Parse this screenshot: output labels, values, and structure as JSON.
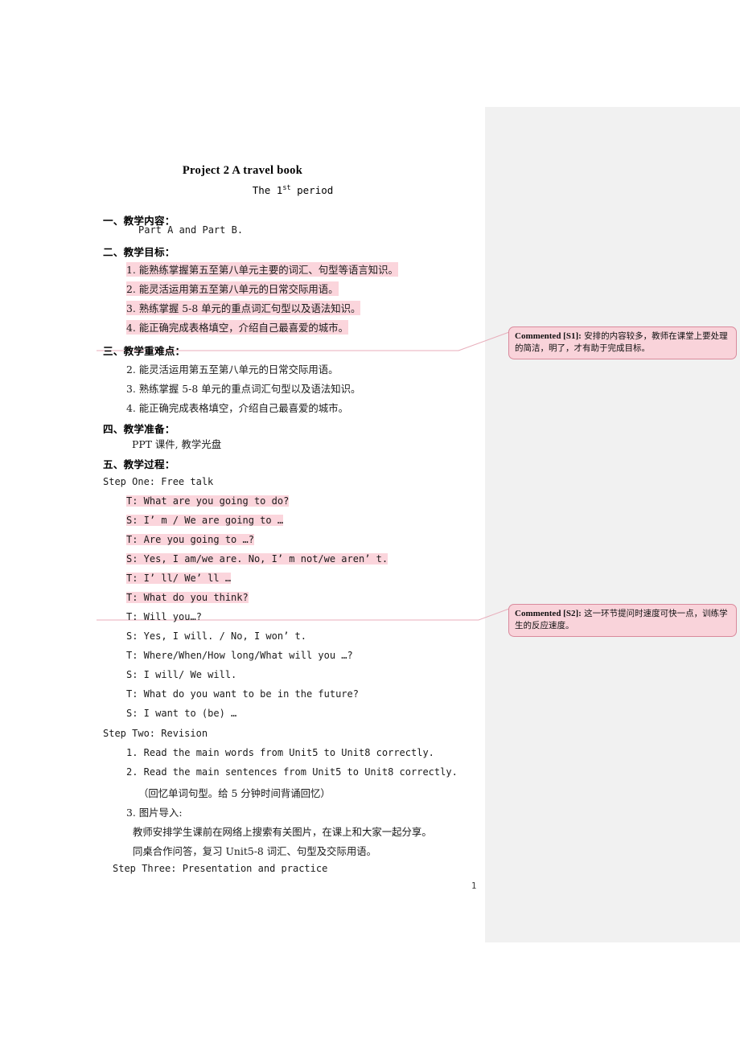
{
  "document": {
    "title": "Project 2 A travel book",
    "period_prefix": "The 1",
    "period_sup": "st",
    "period_suffix": " period",
    "page_number": "1",
    "sections": [
      {
        "heading": "一、教学内容："
      },
      {
        "heading": "二、教学目标："
      },
      {
        "heading": "三、教学重难点："
      },
      {
        "heading": "四、教学准备："
      },
      {
        "heading": "五、教学过程："
      }
    ],
    "content_line": "Part A and Part B.",
    "objectives": [
      "1. 能熟练掌握第五至第八单元主要的词汇、句型等语言知识。",
      "2. 能灵活运用第五至第八单元的日常交际用语。",
      "3. 熟练掌握 5-8 单元的重点词汇句型以及语法知识。",
      "4. 能正确完成表格填空，介绍自己最喜爱的城市。"
    ],
    "key_points": [
      "2. 能灵活运用第五至第八单元的日常交际用语。",
      "3. 熟练掌握 5-8 单元的重点词汇句型以及语法知识。",
      "4. 能正确完成表格填空，介绍自己最喜爱的城市。"
    ],
    "preparation": "PPT 课件, 教学光盘",
    "step_one_label": "Step One: Free talk",
    "step_one_dialogue": [
      "T: What are you going to do?",
      "S: I’ m / We are going to …",
      "T: Are you going to …?",
      "S: Yes, I am/we are. No, I’ m not/we aren’ t.",
      "T: I’ ll/ We’ ll …",
      "T: What do you think?",
      "T: Will you…?",
      "S: Yes, I will. / No, I won’ t.",
      "T: Where/When/How long/What will you …?",
      "S: I will/ We will.",
      "T: What do you want to be in the future?",
      "S: I want to (be) …"
    ],
    "step_two_label": "Step Two: Revision",
    "step_two_items": [
      "1. Read the main words from Unit5 to Unit8 correctly.",
      "2. Read the main sentences from Unit5 to Unit8 correctly.",
      "（回忆单词句型。给 5 分钟时间背诵回忆）",
      "3. 图片导入:",
      "教师安排学生课前在网络上搜索有关图片，在课上和大家一起分享。",
      "同桌合作问答，复习 Unit5-8 词汇、句型及交际用语。"
    ],
    "step_three_label": "Step Three: Presentation and practice"
  },
  "comments": [
    {
      "tag": "Commented [S1]:",
      "text": " 安排的内容较多，教师在课堂上要处理的简洁，明了，才有助于完成目标。"
    },
    {
      "tag": "Commented [S2]:",
      "text": " 这一环节提问时速度可快一点，训练学生的反应速度。"
    }
  ],
  "colors": {
    "highlight": "#fbd5dc",
    "comment_fill": "#f9d3da",
    "comment_border": "#d98a9c",
    "gutter": "#f1f1f1"
  }
}
